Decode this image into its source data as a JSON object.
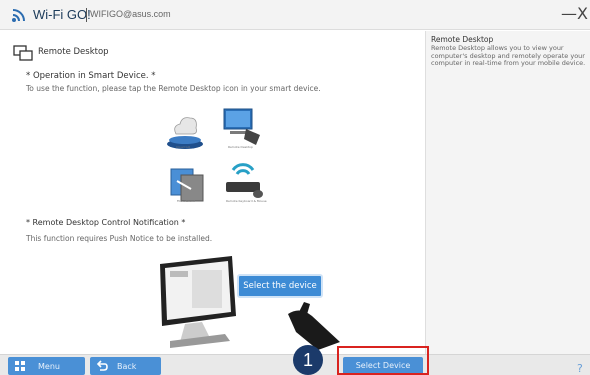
{
  "titlebar": {
    "app_name": "Wi-Fi GO!",
    "account": "WIFIGO@asus.com",
    "minimize_glyph": "—",
    "close_glyph": "X"
  },
  "main": {
    "header_title": "Remote Desktop",
    "operation_title": "* Operation in Smart Device. *",
    "operation_desc": "To use the function, please tap the Remote Desktop icon in your smart device.",
    "app_icons": [
      {
        "label": "Cloud GO",
        "icon": "cloud-go-icon"
      },
      {
        "label": "Remote Desktop",
        "icon": "remote-desktop-icon"
      },
      {
        "label": "File Transfer",
        "icon": "file-transfer-icon"
      },
      {
        "label": "Remote Keyboard & Mouse",
        "icon": "remote-keyboard-mouse-icon"
      }
    ],
    "notification_title": "* Remote Desktop Control Notification *",
    "notification_desc": "This function requires Push Notice to be installed.",
    "callout_label": "Select the device"
  },
  "sidebar": {
    "title": "Remote Desktop",
    "description": "Remote Desktop allows you to view your computer's desktop and remotely operate your computer in real-time from your mobile device."
  },
  "bottom": {
    "menu_label": "Menu",
    "back_label": "Back",
    "select_device_label": "Select Device",
    "step_number": "1",
    "help_glyph": "?"
  },
  "colors": {
    "accent": "#4a90d6",
    "highlight": "#d9231f",
    "badge": "#1b3a6a"
  }
}
